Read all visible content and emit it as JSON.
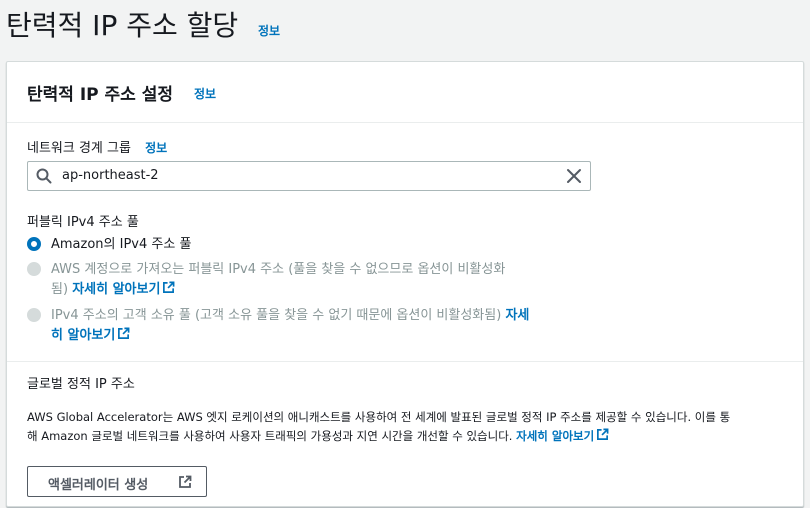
{
  "page": {
    "title": "탄력적 IP 주소 할당",
    "info_link": "정보"
  },
  "panel": {
    "title": "탄력적 IP 주소 설정",
    "info_link": "정보",
    "network_border_group": {
      "label": "네트워크 경계 그룹",
      "info_link": "정보",
      "value": "ap-northeast-2"
    },
    "public_ipv4_pool": {
      "label": "퍼블릭 IPv4 주소 풀",
      "options": [
        {
          "label": "Amazon의 IPv4 주소 풀",
          "selected": true,
          "disabled": false
        },
        {
          "line1": "AWS 계정으로 가져오는 퍼블릭 IPv4 주소 (풀을 찾을 수 없으므로 옵션이 비활성화",
          "line2_prefix": "됨)",
          "link": "자세히 알아보기",
          "selected": false,
          "disabled": true
        },
        {
          "line1_prefix": "IPv4 주소의 고객 소유 풀 (고객 소유 풀을 찾을 수 없기 때문에 옵션이 비활성화됨)",
          "link_part1": "자세",
          "link_part2": "히 알아보기",
          "selected": false,
          "disabled": true
        }
      ]
    },
    "global_static_ip": {
      "label": "글로벌 정적 IP 주소",
      "description_line1": "AWS Global Accelerator는 AWS 엣지 로케이션의 애니캐스트를 사용하여 전 세계에 발표된 글로벌 정적 IP 주소를 제공할 수 있습니다. 이를 통",
      "description_line2": "해 Amazon 글로벌 네트워크를 사용하여 사용자 트래픽의 가용성과 지연 시간을 개선할 수 있습니다.",
      "learn_more": "자세히 알아보기",
      "button_label": "액셀러레이터 생성"
    }
  },
  "colors": {
    "link": "#0073bb",
    "radio_selected": "#0073bb",
    "disabled_text": "#879596"
  }
}
